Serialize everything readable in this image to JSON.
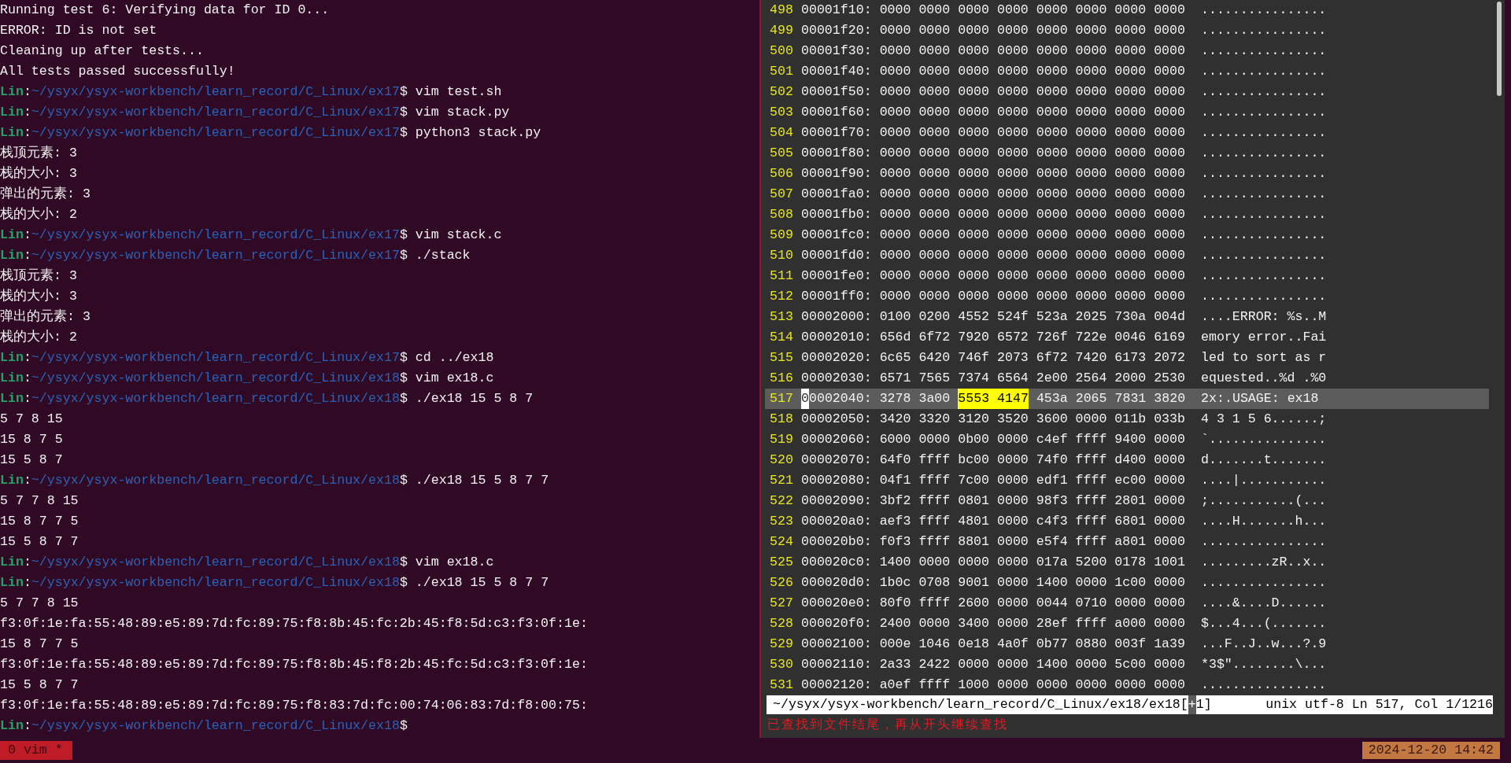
{
  "terminal": {
    "lines": [
      {
        "kind": "output",
        "text": "Running test 6: Verifying data for ID 0..."
      },
      {
        "kind": "output",
        "text": "ERROR: ID is not set"
      },
      {
        "kind": "output",
        "text": "Cleaning up after tests..."
      },
      {
        "kind": "output",
        "text": "All tests passed successfully!"
      },
      {
        "kind": "prompt",
        "user": "Lin",
        "separator": ":",
        "path": "~/ysyx/ysyx-workbench/learn_record/C_Linux/ex17",
        "symbol": "$",
        "command": " vim test.sh"
      },
      {
        "kind": "prompt",
        "user": "Lin",
        "separator": ":",
        "path": "~/ysyx/ysyx-workbench/learn_record/C_Linux/ex17",
        "symbol": "$",
        "command": " vim stack.py"
      },
      {
        "kind": "prompt",
        "user": "Lin",
        "separator": ":",
        "path": "~/ysyx/ysyx-workbench/learn_record/C_Linux/ex17",
        "symbol": "$",
        "command": " python3 stack.py"
      },
      {
        "kind": "output",
        "text": "栈顶元素: 3"
      },
      {
        "kind": "output",
        "text": "栈的大小: 3"
      },
      {
        "kind": "output",
        "text": "弹出的元素: 3"
      },
      {
        "kind": "output",
        "text": "栈的大小: 2"
      },
      {
        "kind": "prompt",
        "user": "Lin",
        "separator": ":",
        "path": "~/ysyx/ysyx-workbench/learn_record/C_Linux/ex17",
        "symbol": "$",
        "command": " vim stack.c"
      },
      {
        "kind": "prompt",
        "user": "Lin",
        "separator": ":",
        "path": "~/ysyx/ysyx-workbench/learn_record/C_Linux/ex17",
        "symbol": "$",
        "command": " ./stack"
      },
      {
        "kind": "output",
        "text": "栈顶元素: 3"
      },
      {
        "kind": "output",
        "text": "栈的大小: 3"
      },
      {
        "kind": "output",
        "text": "弹出的元素: 3"
      },
      {
        "kind": "output",
        "text": "栈的大小: 2"
      },
      {
        "kind": "prompt",
        "user": "Lin",
        "separator": ":",
        "path": "~/ysyx/ysyx-workbench/learn_record/C_Linux/ex17",
        "symbol": "$",
        "command": " cd ../ex18"
      },
      {
        "kind": "prompt",
        "user": "Lin",
        "separator": ":",
        "path": "~/ysyx/ysyx-workbench/learn_record/C_Linux/ex18",
        "symbol": "$",
        "command": " vim ex18.c"
      },
      {
        "kind": "prompt",
        "user": "Lin",
        "separator": ":",
        "path": "~/ysyx/ysyx-workbench/learn_record/C_Linux/ex18",
        "symbol": "$",
        "command": " ./ex18 15 5 8 7"
      },
      {
        "kind": "output",
        "text": "5 7 8 15"
      },
      {
        "kind": "output",
        "text": "15 8 7 5"
      },
      {
        "kind": "output",
        "text": "15 5 8 7"
      },
      {
        "kind": "prompt",
        "user": "Lin",
        "separator": ":",
        "path": "~/ysyx/ysyx-workbench/learn_record/C_Linux/ex18",
        "symbol": "$",
        "command": " ./ex18 15 5 8 7 7"
      },
      {
        "kind": "output",
        "text": "5 7 7 8 15"
      },
      {
        "kind": "output",
        "text": "15 8 7 7 5"
      },
      {
        "kind": "output",
        "text": "15 5 8 7 7"
      },
      {
        "kind": "prompt",
        "user": "Lin",
        "separator": ":",
        "path": "~/ysyx/ysyx-workbench/learn_record/C_Linux/ex18",
        "symbol": "$",
        "command": " vim ex18.c"
      },
      {
        "kind": "prompt",
        "user": "Lin",
        "separator": ":",
        "path": "~/ysyx/ysyx-workbench/learn_record/C_Linux/ex18",
        "symbol": "$",
        "command": " ./ex18 15 5 8 7 7"
      },
      {
        "kind": "output",
        "text": "5 7 7 8 15"
      },
      {
        "kind": "output",
        "text": "f3:0f:1e:fa:55:48:89:e5:89:7d:fc:89:75:f8:8b:45:fc:2b:45:f8:5d:c3:f3:0f:1e:"
      },
      {
        "kind": "output",
        "text": "15 8 7 7 5"
      },
      {
        "kind": "output",
        "text": "f3:0f:1e:fa:55:48:89:e5:89:7d:fc:89:75:f8:8b:45:f8:2b:45:fc:5d:c3:f3:0f:1e:"
      },
      {
        "kind": "output",
        "text": "15 5 8 7 7"
      },
      {
        "kind": "output",
        "text": "f3:0f:1e:fa:55:48:89:e5:89:7d:fc:89:75:f8:83:7d:fc:00:74:06:83:7d:f8:00:75:"
      },
      {
        "kind": "prompt",
        "user": "Lin",
        "separator": ":",
        "path": "~/ysyx/ysyx-workbench/learn_record/C_Linux/ex18",
        "symbol": "$"
      }
    ]
  },
  "editor": {
    "rows": [
      {
        "number": "498",
        "address": "00001f10:",
        "hex": "0000 0000 0000 0000 0000 0000 0000 0000",
        "ascii": "................",
        "current": false
      },
      {
        "number": "499",
        "address": "00001f20:",
        "hex": "0000 0000 0000 0000 0000 0000 0000 0000",
        "ascii": "................",
        "current": false
      },
      {
        "number": "500",
        "address": "00001f30:",
        "hex": "0000 0000 0000 0000 0000 0000 0000 0000",
        "ascii": "................",
        "current": false
      },
      {
        "number": "501",
        "address": "00001f40:",
        "hex": "0000 0000 0000 0000 0000 0000 0000 0000",
        "ascii": "................",
        "current": false
      },
      {
        "number": "502",
        "address": "00001f50:",
        "hex": "0000 0000 0000 0000 0000 0000 0000 0000",
        "ascii": "................",
        "current": false
      },
      {
        "number": "503",
        "address": "00001f60:",
        "hex": "0000 0000 0000 0000 0000 0000 0000 0000",
        "ascii": "................",
        "current": false
      },
      {
        "number": "504",
        "address": "00001f70:",
        "hex": "0000 0000 0000 0000 0000 0000 0000 0000",
        "ascii": "................",
        "current": false
      },
      {
        "number": "505",
        "address": "00001f80:",
        "hex": "0000 0000 0000 0000 0000 0000 0000 0000",
        "ascii": "................",
        "current": false
      },
      {
        "number": "506",
        "address": "00001f90:",
        "hex": "0000 0000 0000 0000 0000 0000 0000 0000",
        "ascii": "................",
        "current": false
      },
      {
        "number": "507",
        "address": "00001fa0:",
        "hex": "0000 0000 0000 0000 0000 0000 0000 0000",
        "ascii": "................",
        "current": false
      },
      {
        "number": "508",
        "address": "00001fb0:",
        "hex": "0000 0000 0000 0000 0000 0000 0000 0000",
        "ascii": "................",
        "current": false
      },
      {
        "number": "509",
        "address": "00001fc0:",
        "hex": "0000 0000 0000 0000 0000 0000 0000 0000",
        "ascii": "................",
        "current": false
      },
      {
        "number": "510",
        "address": "00001fd0:",
        "hex": "0000 0000 0000 0000 0000 0000 0000 0000",
        "ascii": "................",
        "current": false
      },
      {
        "number": "511",
        "address": "00001fe0:",
        "hex": "0000 0000 0000 0000 0000 0000 0000 0000",
        "ascii": "................",
        "current": false
      },
      {
        "number": "512",
        "address": "00001ff0:",
        "hex": "0000 0000 0000 0000 0000 0000 0000 0000",
        "ascii": "................",
        "current": false
      },
      {
        "number": "513",
        "address": "00002000:",
        "hex": "0100 0200 4552 524f 523a 2025 730a 004d",
        "ascii": "....ERROR: %s..M",
        "current": false
      },
      {
        "number": "514",
        "address": "00002010:",
        "hex": "656d 6f72 7920 6572 726f 722e 0046 6169",
        "ascii": "emory error..Fai",
        "current": false
      },
      {
        "number": "515",
        "address": "00002020:",
        "hex": "6c65 6420 746f 2073 6f72 7420 6173 2072",
        "ascii": "led to sort as r",
        "current": false
      },
      {
        "number": "516",
        "address": "00002030:",
        "hex": "6571 7565 7374 6564 2e00 2564 2000 2530",
        "ascii": "equested..%d .%0",
        "current": false
      },
      {
        "number": "517",
        "address": "00002040:",
        "hex": "3278 3a00",
        "match": "5553 4147",
        "hex_after": "453a 2065 7831 3820",
        "ascii": "2x:.USAGE: ex18",
        "current": true,
        "cursor": true
      },
      {
        "number": "518",
        "address": "00002050:",
        "hex": "3420 3320 3120 3520 3600 0000 011b 033b",
        "ascii": "4 3 1 5 6......;",
        "current": false
      },
      {
        "number": "519",
        "address": "00002060:",
        "hex": "6000 0000 0b00 0000 c4ef ffff 9400 0000",
        "ascii": "`...............",
        "current": false
      },
      {
        "number": "520",
        "address": "00002070:",
        "hex": "64f0 ffff bc00 0000 74f0 ffff d400 0000",
        "ascii": "d.......t.......",
        "current": false
      },
      {
        "number": "521",
        "address": "00002080:",
        "hex": "04f1 ffff 7c00 0000 edf1 ffff ec00 0000",
        "ascii": "....|...........",
        "current": false
      },
      {
        "number": "522",
        "address": "00002090:",
        "hex": "3bf2 ffff 0801 0000 98f3 ffff 2801 0000",
        "ascii": ";...........(...",
        "current": false
      },
      {
        "number": "523",
        "address": "000020a0:",
        "hex": "aef3 ffff 4801 0000 c4f3 ffff 6801 0000",
        "ascii": "....H.......h...",
        "current": false
      },
      {
        "number": "524",
        "address": "000020b0:",
        "hex": "f0f3 ffff 8801 0000 e5f4 ffff a801 0000",
        "ascii": "................",
        "current": false
      },
      {
        "number": "525",
        "address": "000020c0:",
        "hex": "1400 0000 0000 0000 017a 5200 0178 1001",
        "ascii": ".........zR..x..",
        "current": false
      },
      {
        "number": "526",
        "address": "000020d0:",
        "hex": "1b0c 0708 9001 0000 1400 0000 1c00 0000",
        "ascii": "................",
        "current": false
      },
      {
        "number": "527",
        "address": "000020e0:",
        "hex": "80f0 ffff 2600 0000 0044 0710 0000 0000",
        "ascii": "....&....D......",
        "current": false
      },
      {
        "number": "528",
        "address": "000020f0:",
        "hex": "2400 0000 3400 0000 28ef ffff a000 0000",
        "ascii": "$...4...(.......",
        "current": false
      },
      {
        "number": "529",
        "address": "00002100:",
        "hex": "000e 1046 0e18 4a0f 0b77 0880 003f 1a39",
        "ascii": "...F..J..w...?.9",
        "current": false
      },
      {
        "number": "530",
        "address": "00002110:",
        "hex": "2a33 2422 0000 0000 1400 0000 5c00 0000",
        "ascii": "*3$\"........\\...",
        "current": false
      },
      {
        "number": "531",
        "address": "00002120:",
        "hex": "a0ef ffff 1000 0000 0000 0000 0000 0000",
        "ascii": "................",
        "current": false
      }
    ],
    "status_line": {
      "file": "~/ysyx/ysyx-workbench/learn_record/C_Linux/ex18/ex18[",
      "flag": "+",
      "buffer": "1]",
      "info": "unix utf-8 Ln 517, Col 1/1216"
    },
    "message": "已查找到文件结尾，再从开头继续查找"
  },
  "tmux_bar": {
    "window": "0 vim *",
    "clock": "2024-12-20 14:42"
  }
}
